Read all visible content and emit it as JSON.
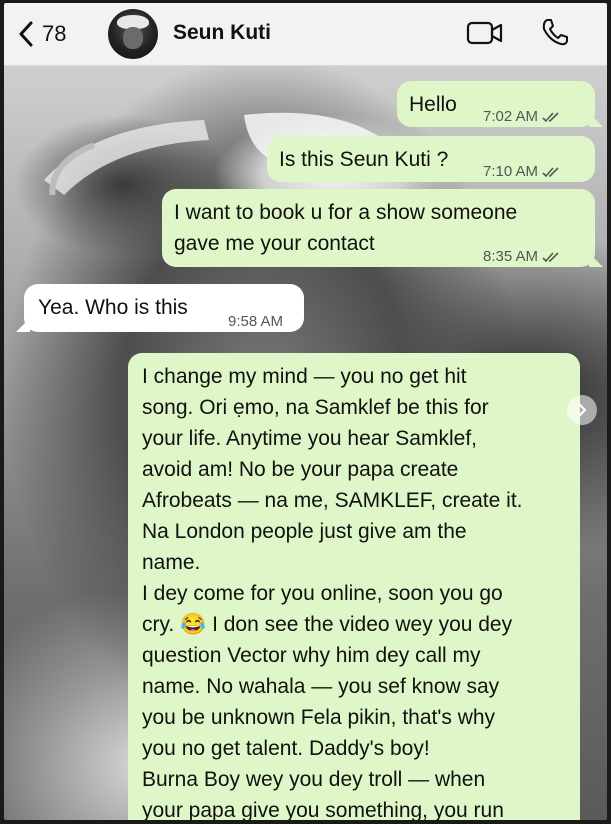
{
  "header": {
    "back_count": "78",
    "contact_name": "Seun Kuti",
    "icons": {
      "back": "chevron-left-icon",
      "video": "video-camera-icon",
      "call": "phone-icon"
    }
  },
  "messages": [
    {
      "direction": "outgoing",
      "text": "Hello",
      "time": "7:02 AM",
      "status": "read-double-check"
    },
    {
      "direction": "outgoing",
      "text": "Is this Seun Kuti ?",
      "time": "7:10 AM",
      "status": "read-double-check"
    },
    {
      "direction": "outgoing",
      "lines": [
        "I want to book u for a show someone",
        "gave me your contact"
      ],
      "time": "8:35 AM",
      "status": "read-double-check"
    },
    {
      "direction": "incoming",
      "text": "Yea. Who is this",
      "time": "9:58 AM"
    },
    {
      "direction": "outgoing",
      "lines": [
        "I change my mind — you no get hit",
        "song. Ori ẹmo, na Samklef be this for",
        "your life. Anytime you hear Samklef,",
        "avoid am! No be your papa create",
        "Afrobeats — na me, SAMKLEF, create it.",
        "Na London people just give am the",
        "name.",
        "I dey come for you online, soon you go",
        "cry. 😂 I don see the video wey you dey",
        "question Vector why him dey call my",
        "name. No wahala — you sef know say",
        "you be unknown Fela pikin, that's why",
        "you no get talent. Daddy's boy!",
        "Burna Boy wey you dey troll — when",
        "your papa give you something, you run"
      ]
    }
  ],
  "colors": {
    "outgoing_bubble": "#dff7c8",
    "incoming_bubble": "#ffffff",
    "header_bg": "#f2f2f2",
    "read_ticks": "#555555"
  }
}
